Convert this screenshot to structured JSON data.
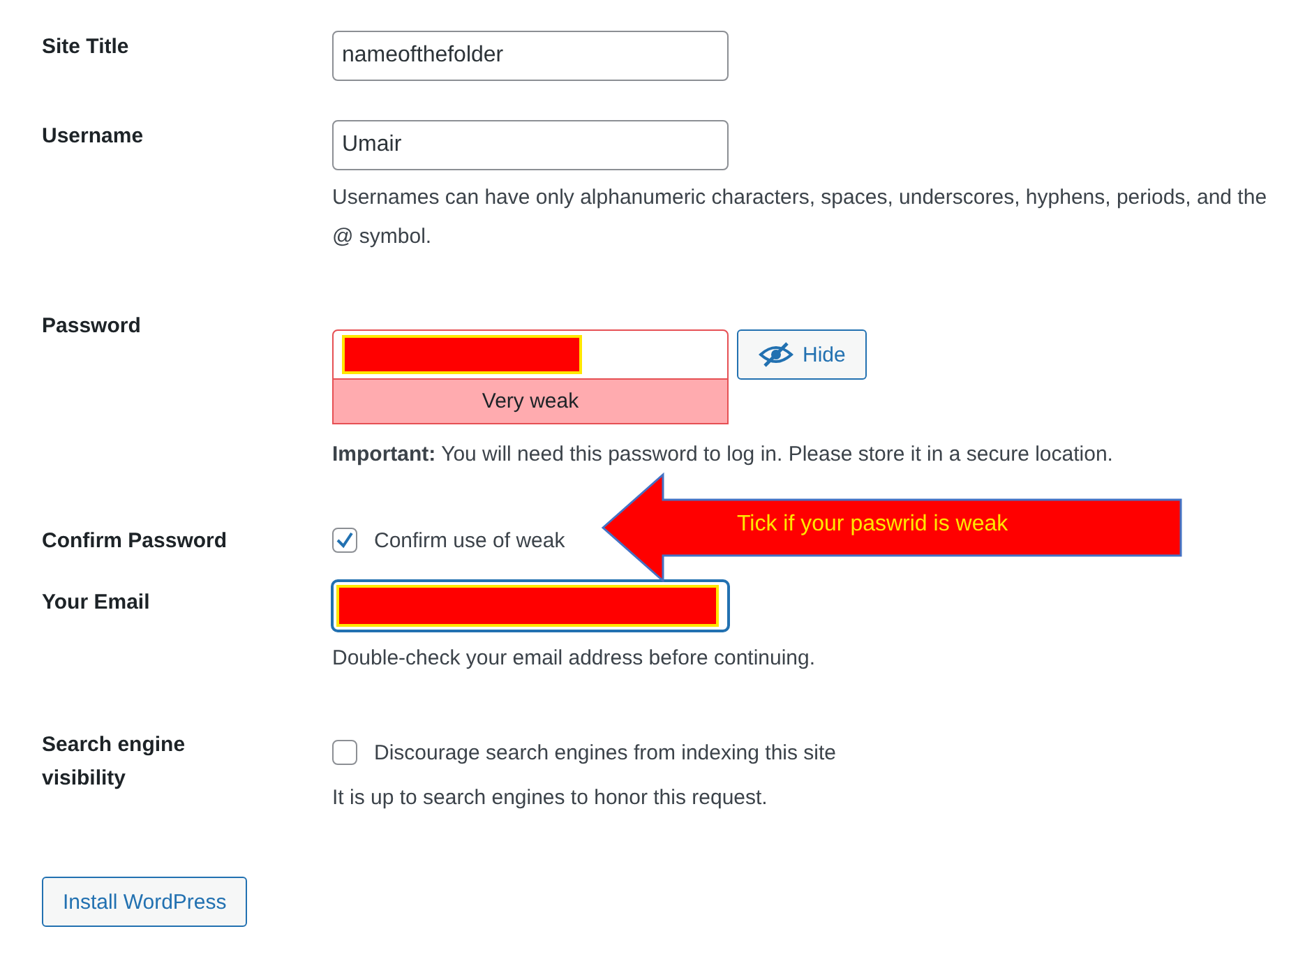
{
  "form": {
    "rows": [
      {
        "kind": "text",
        "label": "Site Title",
        "value": "nameofthefolder"
      },
      {
        "kind": "text",
        "label": "Username",
        "value": "Umair",
        "hint": "Usernames can have only alphanumeric characters, spaces, underscores, hyphens, periods, and the @ symbol."
      },
      {
        "kind": "password",
        "label": "Password",
        "redacted": true,
        "toggle": "Hide",
        "strength": "Very weak",
        "hint": "**Important:** You will need this password to log in. Please store it in a secure location."
      },
      {
        "kind": "checkbox",
        "label": "Confirm Password",
        "checked": true,
        "option": "Confirm use of weak"
      },
      {
        "kind": "email",
        "label": "Your Email",
        "redacted": true,
        "focused": true,
        "hint": "Double-check your email address before continuing."
      },
      {
        "kind": "checkbox",
        "label": "Search engine visibility",
        "checked": false,
        "option": "Discourage search engines from indexing this site",
        "hint": "It is up to search engines to honor this request."
      }
    ],
    "submit": "Install WordPress"
  },
  "callout": {
    "text": "Tick if your paswrid is weak"
  }
}
